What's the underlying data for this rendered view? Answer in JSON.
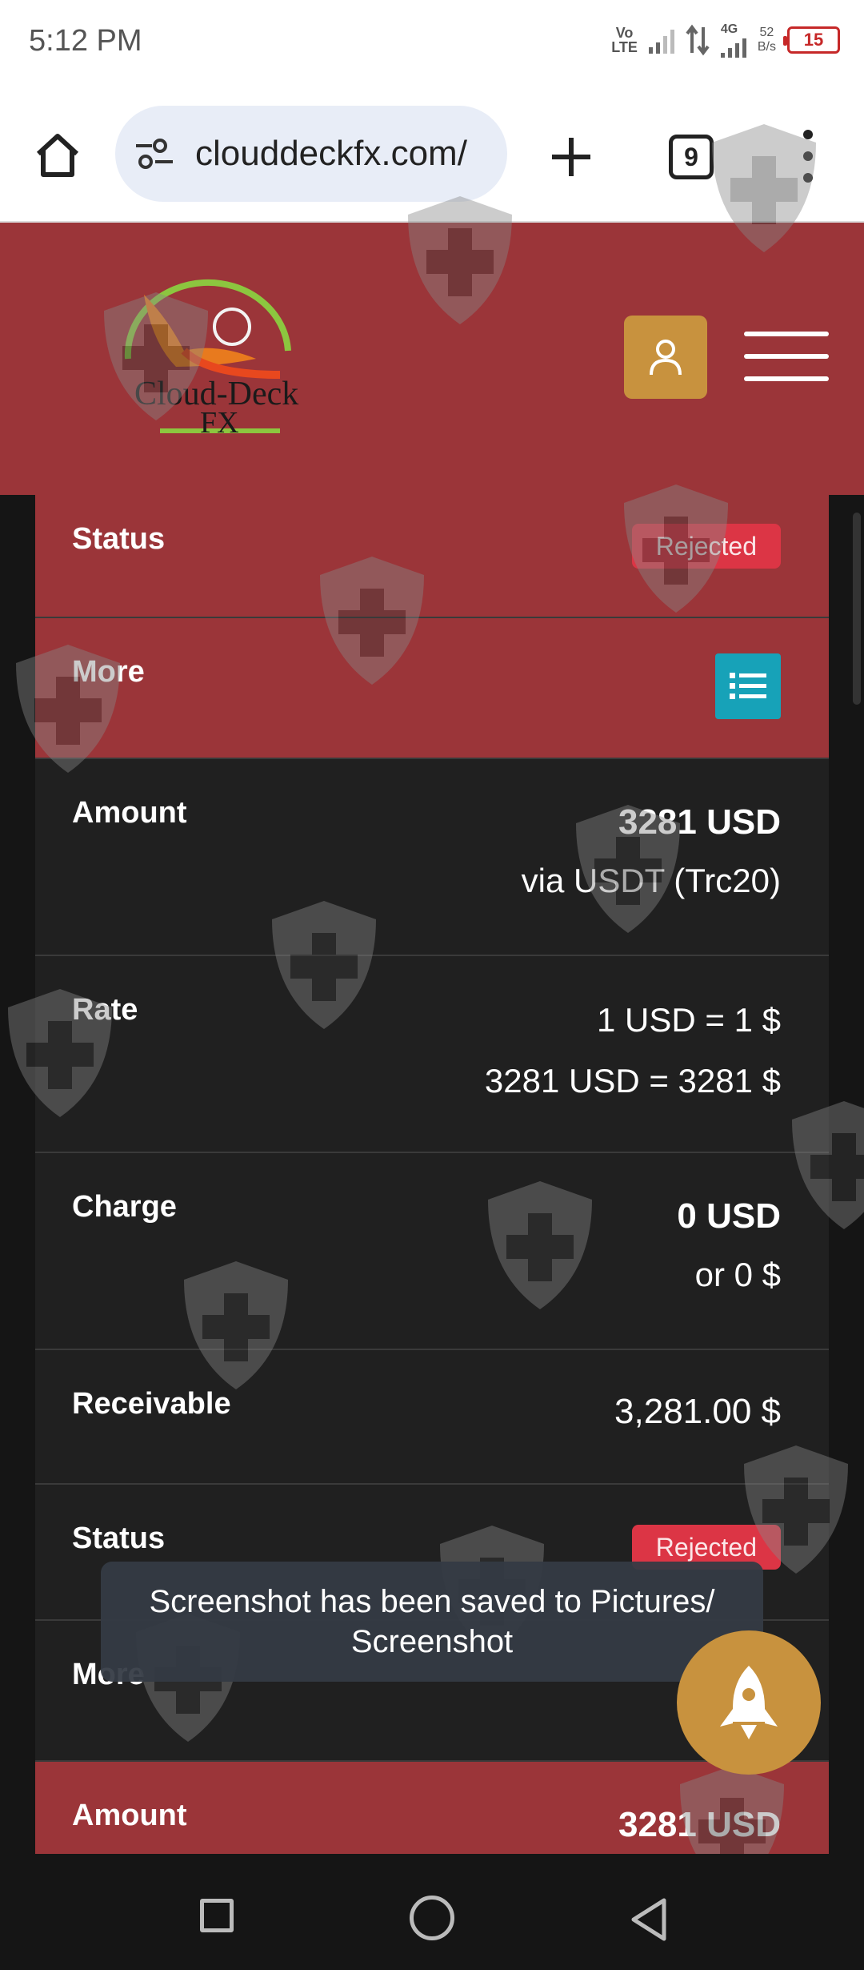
{
  "status_bar": {
    "time": "5:12 PM",
    "volte_line1": "Vo",
    "volte_line2": "LTE",
    "network_label": "4G",
    "speed_value": "52",
    "speed_unit": "B/s",
    "battery": "15"
  },
  "browser": {
    "url": "clouddeckfx.com/",
    "tab_count": "9"
  },
  "site": {
    "brand_line1": "Cloud-Deck",
    "brand_line2": "FX"
  },
  "rows": [
    {
      "label": "Status",
      "value": "Rejected"
    },
    {
      "label": "More"
    },
    {
      "label": "Amount",
      "value": "3281 USD",
      "sub": "via USDT (Trc20)"
    },
    {
      "label": "Rate",
      "value": "1 USD = 1 $",
      "sub": "3281 USD = 3281 $"
    },
    {
      "label": "Charge",
      "value": "0 USD",
      "sub": "or 0 $"
    },
    {
      "label": "Receivable",
      "value": "3,281.00 $"
    },
    {
      "label": "Status",
      "value": "Rejected"
    },
    {
      "label": "More"
    },
    {
      "label": "Amount",
      "value": "3281 USD"
    }
  ],
  "toast": {
    "text": "Screenshot has been saved to  Pictures/ Screenshot"
  },
  "colors": {
    "header_red": "#9b3539",
    "rejected_badge": "#dc3545",
    "list_button": "#17a2b8",
    "receivable_green": "#28a745",
    "accent_gold": "#c8923e"
  },
  "icons": [
    "home-icon",
    "tune-icon",
    "plus-icon",
    "tabs-icon",
    "more-vert-icon",
    "user-icon",
    "hamburger-icon",
    "list-icon",
    "rocket-icon",
    "shield-cross-icon"
  ]
}
